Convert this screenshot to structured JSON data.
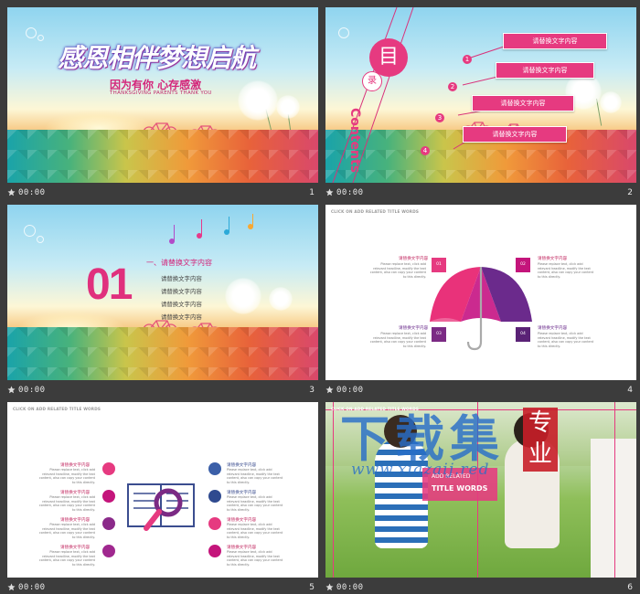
{
  "slides": [
    {
      "number": "1",
      "duration": "00:00",
      "title_art": "感恩相伴梦想启航",
      "subtitle": "因为有你  心存感激",
      "subtitle_en": "THANKSGIVING PARENTS THANK YOU"
    },
    {
      "number": "2",
      "duration": "00:00",
      "toc_char1": "目",
      "toc_char2": "录",
      "toc_en": "Contents",
      "items": [
        {
          "n": "1",
          "label": "请替换文字内容"
        },
        {
          "n": "2",
          "label": "请替换文字内容"
        },
        {
          "n": "3",
          "label": "请替换文字内容"
        },
        {
          "n": "4",
          "label": "请替换文字内容"
        }
      ]
    },
    {
      "number": "3",
      "duration": "00:00",
      "section_no": "01",
      "section_head": "一、请替换文字内容",
      "lines": [
        "请替换文字内容",
        "请替换文字内容",
        "请替换文字内容",
        "请替换文字内容"
      ]
    },
    {
      "number": "4",
      "duration": "00:00",
      "header": "CLICK ON ADD RELATED TITLE WORDS",
      "blocks": [
        {
          "tag": "01",
          "label": "请替换文字内容",
          "body": "Please replace text, click add relevant headline, modify the text content, also can copy your content to this directly."
        },
        {
          "tag": "02",
          "label": "请替换文字内容",
          "body": "Please replace text, click add relevant headline, modify the text content, also can copy your content to this directly."
        },
        {
          "tag": "03",
          "label": "请替换文字内容",
          "body": "Please replace text, click add relevant headline, modify the text content, also can copy your content to this directly."
        },
        {
          "tag": "04",
          "label": "请替换文字内容",
          "body": "Please replace text, click add relevant headline, modify the text content, also can copy your content to this directly."
        }
      ]
    },
    {
      "number": "5",
      "duration": "00:00",
      "header": "CLICK ON ADD RELATED TITLE WORDS",
      "left": [
        {
          "label": "请替换文字内容",
          "body": "Please replace text, click add relevant headline, modify the text content, also can copy your content to this directly.",
          "icon": "phone-icon"
        },
        {
          "label": "请替换文字内容",
          "body": "Please replace text, click add relevant headline, modify the text content, also can copy your content to this directly.",
          "icon": "globe-icon"
        },
        {
          "label": "请替换文字内容",
          "body": "Please replace text, click add relevant headline, modify the text content, also can copy your content to this directly.",
          "icon": "calendar-icon"
        },
        {
          "label": "请替换文字内容",
          "body": "Please replace text, click add relevant headline, modify the text content, also can copy your content to this directly.",
          "icon": "bulb-icon"
        }
      ],
      "right": [
        {
          "label": "请替换文字内容",
          "body": "Please replace text, click add relevant headline, modify the text content, also can copy your content to this directly.",
          "icon": "pin-icon"
        },
        {
          "label": "请替换文字内容",
          "body": "Please replace text, click add relevant headline, modify the text content, also can copy your content to this directly.",
          "icon": "cloud-icon"
        },
        {
          "label": "请替换文字内容",
          "body": "Please replace text, click add relevant headline, modify the text content, also can copy your content to this directly.",
          "icon": "home-icon"
        },
        {
          "label": "请替换文字内容",
          "body": "Please replace text, click add relevant headline, modify the text content, also can copy your content to this directly.",
          "icon": "group-icon"
        }
      ]
    },
    {
      "number": "6",
      "duration": "00:00",
      "header": "CLICK ON ADD RELATED TITLE WORDS",
      "tag1": "ADD RELATED",
      "tag2": "TITLE WORDS"
    }
  ],
  "watermark": {
    "big": "下载集",
    "badge1": "专",
    "badge2": "业",
    "url": "www.xiazaij.red"
  },
  "colors": {
    "accent": "#e63a80",
    "purple": "#6a2b8b",
    "bar_bg": "#3c3c3c"
  }
}
